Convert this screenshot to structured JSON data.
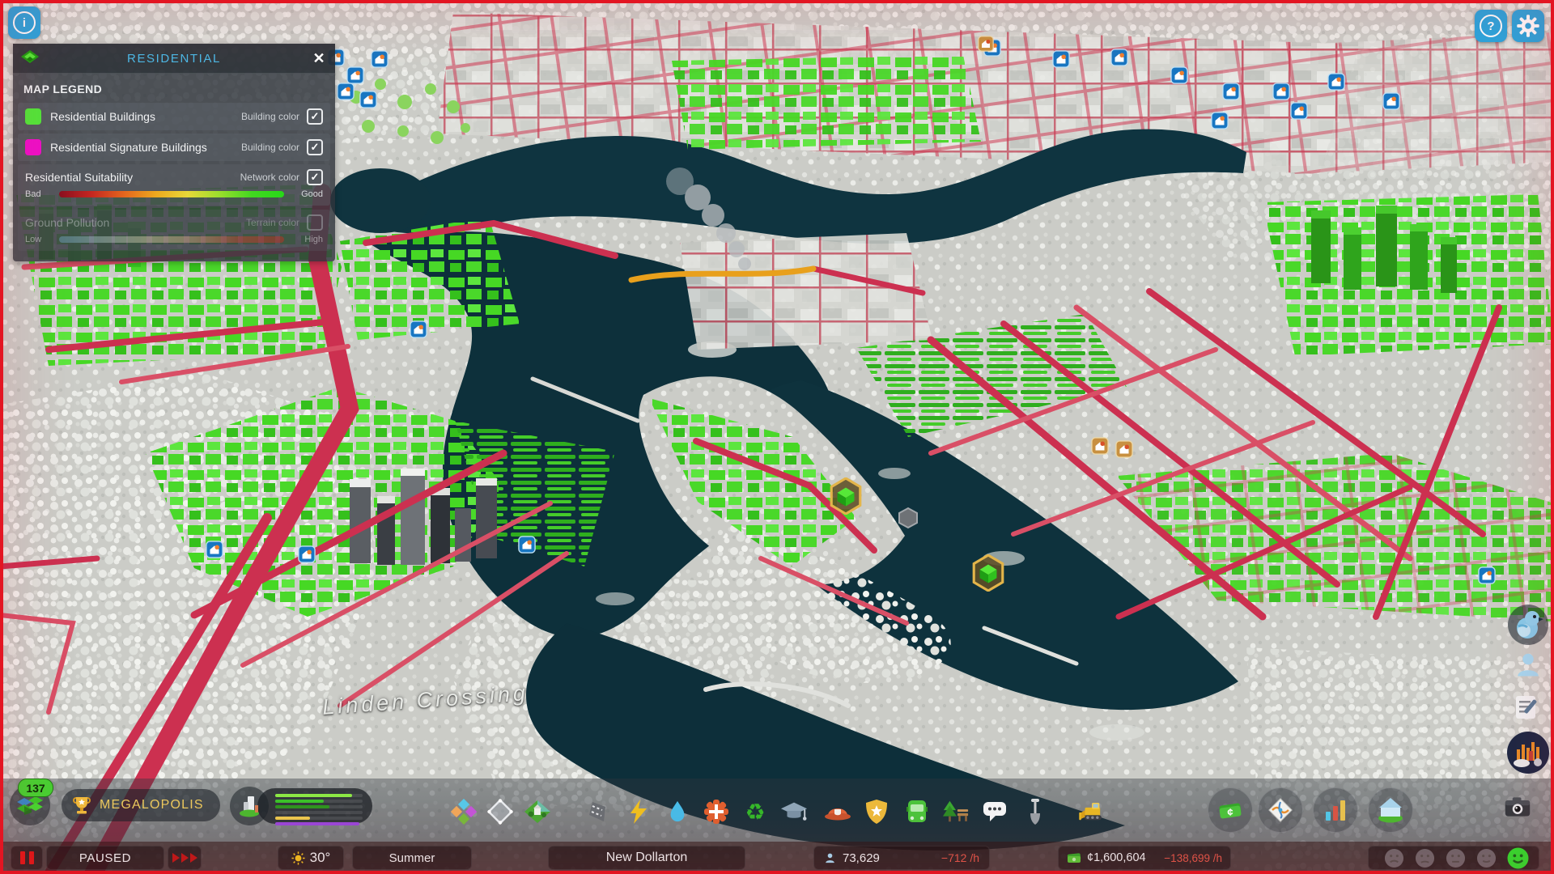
{
  "icons": {
    "info": "i",
    "help": "?",
    "close": "✕",
    "check": "✓"
  },
  "colors": {
    "accent_blue": "#2aa6de",
    "residential_green": "#52e63a",
    "signature_magenta": "#ee10c8",
    "road_overlay_red": "#cc3050",
    "negative_red": "#e2574a",
    "milestone_gold": "#ecc95e",
    "suitability_gradient": [
      "#8a1020",
      "#e4641e",
      "#e8d838",
      "#27d818"
    ],
    "pollution_gradient": [
      "#6f9fc4",
      "#d3c6a6",
      "#c43326"
    ]
  },
  "infoview_panel": {
    "title": "RESIDENTIAL",
    "map_legend_title": "MAP LEGEND",
    "rows": [
      {
        "label": "Residential Buildings",
        "mode": "Building color",
        "checked": true,
        "swatch_style": "background:#52e63a"
      },
      {
        "label": "Residential Signature Buildings",
        "mode": "Building color",
        "checked": true,
        "swatch_style": "background:#ee10c8"
      }
    ],
    "suitability": {
      "label": "Residential Suitability",
      "mode": "Network color",
      "checked": true,
      "min_label": "Bad",
      "max_label": "Good"
    },
    "pollution": {
      "label": "Ground Pollution",
      "mode": "Terrain color",
      "checked": false,
      "min_label": "Low",
      "max_label": "High"
    }
  },
  "map": {
    "district_label": "Linden Crossing"
  },
  "hud": {
    "xp_level": "137",
    "milestone": "MEGALOPOLIS",
    "demand": [
      {
        "style": "width:88%;background:#8ce845"
      },
      {
        "style": "width:56%;background:#3cc22a"
      },
      {
        "style": "width:62%;background:#2f9420"
      },
      {
        "style": "width:0%;background:transparent"
      },
      {
        "style": "width:40%;background:#ecc84e"
      },
      {
        "style": "width:96%;background:#9a48d8"
      }
    ],
    "toolbar_icon_names": [
      "zones",
      "areas",
      "landscaping",
      "roads",
      "electricity",
      "water-sewage",
      "healthcare",
      "garbage",
      "education",
      "fire-rescue",
      "police",
      "transportation",
      "parks-recreation",
      "communications",
      "terraforming",
      "bulldozer",
      "economy",
      "map-views",
      "statistics",
      "city-information",
      "photo-mode"
    ]
  },
  "status_bar": {
    "speed_state": "PAUSED",
    "temperature": "30°",
    "season": "Summer",
    "city_name": "New Dollarton",
    "population": "73,629",
    "population_trend": "−712 /h",
    "treasury": "¢1,600,604",
    "treasury_trend": "−138,699 /h"
  }
}
